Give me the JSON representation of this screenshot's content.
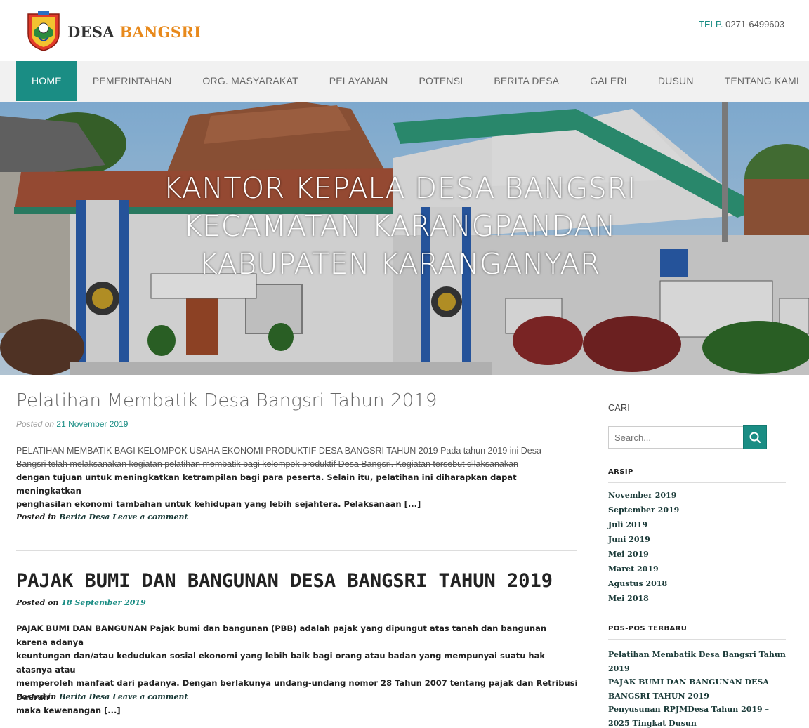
{
  "site": {
    "title_part1": "DESA",
    "title_part2": "BANGSRI",
    "telp_label": "TELP.",
    "telp_number": "0271-6499603"
  },
  "nav": {
    "items": [
      {
        "label": "HOME",
        "active": true
      },
      {
        "label": "PEMERINTAHAN"
      },
      {
        "label": "ORG. MASYARAKAT"
      },
      {
        "label": "PELAYANAN"
      },
      {
        "label": "POTENSI"
      },
      {
        "label": "BERITA DESA"
      },
      {
        "label": "GALERI"
      },
      {
        "label": "DUSUN"
      },
      {
        "label": "TENTANG KAMI"
      }
    ]
  },
  "hero": {
    "line1": "KANTOR KEPALA DESA BANGSRI",
    "line2": "KECAMATAN KARANGPANDAN",
    "line3": "KABUPATEN KARANGANYAR"
  },
  "posts": [
    {
      "title": "Pelatihan Membatik Desa Bangsri Tahun 2019",
      "posted_prefix": "Posted on",
      "date": "21 November 2019",
      "excerpt_line1": "PELATIHAN MEMBATIK BAGI KELOMPOK USAHA EKONOMI PRODUKTIF DESA BANGSRI TAHUN 2019   Pada tahun 2019 ini Desa",
      "excerpt_line2": "Bangsri telah melaksanakan kegiatan pelatihan membatik bagi kelompok produktif Desa Bangsri. Kegiatan tersebut dilaksanakan",
      "excerpt_line3": "dengan tujuan untuk meningkatkan ketrampilan bagi para peserta. Selain itu, pelatihan ini diharapkan dapat meningkatkan",
      "excerpt_line4": "penghasilan ekonomi tambahan untuk kehidupan yang lebih sejahtera. Pelaksanaan [...]",
      "meta_posted_in": "Posted in",
      "meta_category": "Berita Desa",
      "meta_comment": "Leave a comment"
    },
    {
      "title": "PAJAK BUMI DAN BANGUNAN DESA BANGSRI TAHUN 2019",
      "posted_prefix": "Posted on",
      "date": "18 September 2019",
      "excerpt_line1": "PAJAK BUMI DAN BANGUNAN Pajak bumi dan bangunan (PBB) adalah pajak yang dipungut atas tanah dan bangunan karena adanya",
      "excerpt_line2": "keuntungan dan/atau kedudukan sosial ekonomi yang lebih baik bagi orang atau badan yang mempunyai suatu hak atasnya atau",
      "excerpt_line3": "memperoleh manfaat dari padanya. Dengan berlakunya undang-undang nomor 28 Tahun 2007 tentang pajak dan Retribusi Daerah",
      "excerpt_line4": "maka kewenangan [...]",
      "meta_posted_in": "Posted in",
      "meta_category": "Berita Desa",
      "meta_comment": "Leave a comment"
    }
  ],
  "sidebar": {
    "search_heading": "CARI",
    "search_placeholder": "Search...",
    "archive_heading": "ARSIP",
    "archives": [
      "November 2019",
      "September 2019",
      "Juli 2019",
      "Juni 2019",
      "Mei 2019",
      "Maret 2019",
      "Agustus 2018",
      "Mei 2018"
    ],
    "recent_heading": "POS-POS TERBARU",
    "recent": [
      "Pelatihan Membatik Desa Bangsri Tahun 2019",
      "PAJAK BUMI DAN BANGUNAN DESA BANGSRI TAHUN 2019",
      "Penyusunan RPJMDesa Tahun 2019 – 2025 Tingkat Dusun"
    ]
  },
  "colors": {
    "accent": "#1a8d84",
    "brand_orange": "#e8891b"
  }
}
